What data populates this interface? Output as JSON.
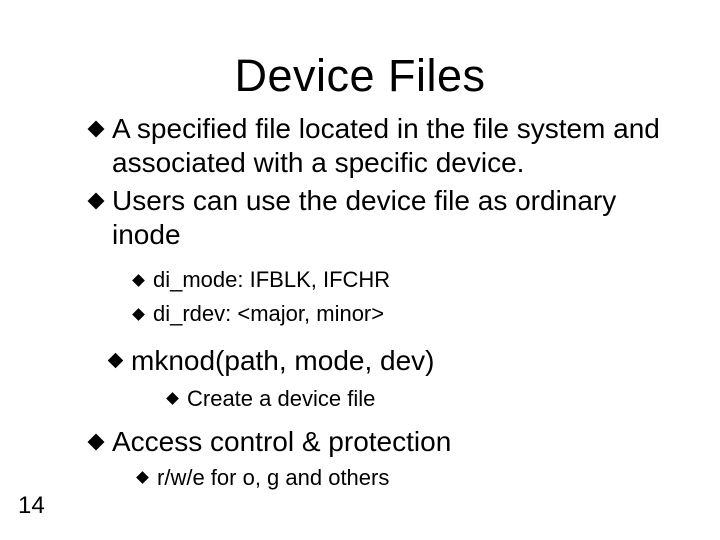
{
  "title": "Device Files",
  "bullets": {
    "b1_lead": "A",
    "b1_rest": " specified file located in the file system and associated with a specific device.",
    "b2_lead": "Users",
    "b2_rest": " can use the device file as ordinary inode",
    "b2_sub1": "di_mode: IFBLK, IFCHR",
    "b2_sub2": "di_rdev: <major, minor>",
    "b3": "mknod(path, mode, dev)",
    "b3_sub1_lead": "Create",
    "b3_sub1_rest": " a device file",
    "b4_lead": "Access",
    "b4_rest": " control & protection",
    "b4_sub1_lead": "r/w/e",
    "b4_sub1_rest": " for o, g and others"
  },
  "page_number": "14"
}
